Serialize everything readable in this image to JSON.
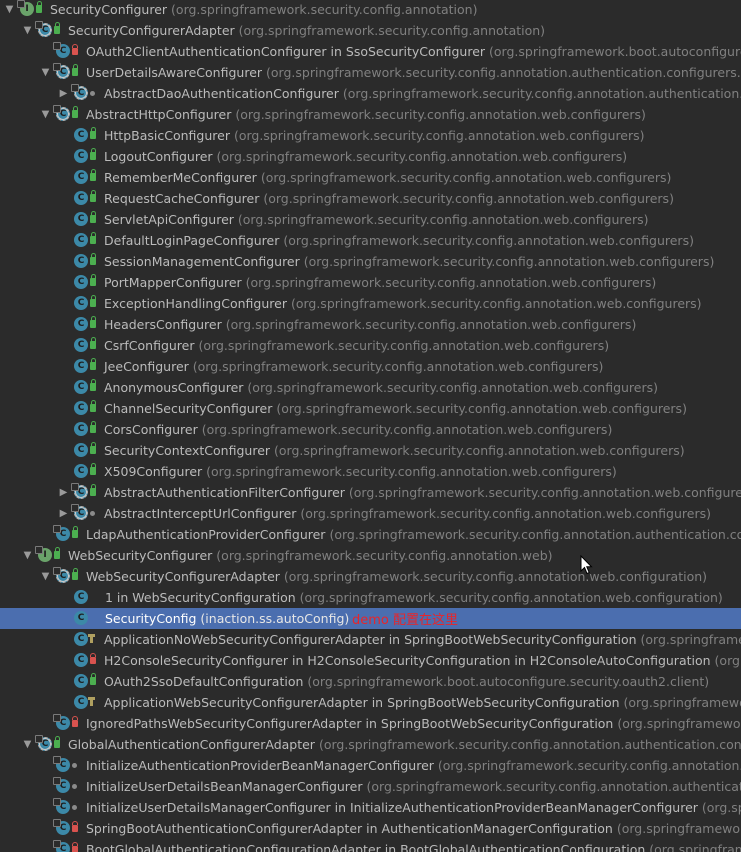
{
  "tree": [
    {
      "name": "SecurityConfigurer",
      "pkg": "(org.springframework.security.config.annotation)",
      "level": 0,
      "arrow": "down",
      "icon": "interface",
      "vis": "public"
    },
    {
      "name": "SecurityConfigurerAdapter",
      "pkg": "(org.springframework.security.config.annotation)",
      "level": 1,
      "arrow": "down",
      "icon": "abstract-class",
      "vis": "public"
    },
    {
      "name": "OAuth2ClientAuthenticationConfigurer in SsoSecurityConfigurer",
      "pkg": "(org.springframework.boot.autoconfigure.securit",
      "level": 2,
      "arrow": "none",
      "icon": "class",
      "vis": "private"
    },
    {
      "name": "UserDetailsAwareConfigurer",
      "pkg": "(org.springframework.security.config.annotation.authentication.configurers.userdeta",
      "level": 2,
      "arrow": "down",
      "icon": "abstract-class",
      "vis": "public"
    },
    {
      "name": "AbstractDaoAuthenticationConfigurer",
      "pkg": "(org.springframework.security.config.annotation.authentication.configur",
      "level": 3,
      "arrow": "right",
      "icon": "abstract-class",
      "vis": "package"
    },
    {
      "name": "AbstractHttpConfigurer",
      "pkg": "(org.springframework.security.config.annotation.web.configurers)",
      "level": 2,
      "arrow": "down",
      "icon": "abstract-class",
      "vis": "public"
    },
    {
      "name": "HttpBasicConfigurer",
      "pkg": "(org.springframework.security.config.annotation.web.configurers)",
      "level": 3,
      "arrow": "none",
      "icon": "class",
      "vis": "public"
    },
    {
      "name": "LogoutConfigurer",
      "pkg": "(org.springframework.security.config.annotation.web.configurers)",
      "level": 3,
      "arrow": "none",
      "icon": "class",
      "vis": "public"
    },
    {
      "name": "RememberMeConfigurer",
      "pkg": "(org.springframework.security.config.annotation.web.configurers)",
      "level": 3,
      "arrow": "none",
      "icon": "class",
      "vis": "public"
    },
    {
      "name": "RequestCacheConfigurer",
      "pkg": "(org.springframework.security.config.annotation.web.configurers)",
      "level": 3,
      "arrow": "none",
      "icon": "class",
      "vis": "public"
    },
    {
      "name": "ServletApiConfigurer",
      "pkg": "(org.springframework.security.config.annotation.web.configurers)",
      "level": 3,
      "arrow": "none",
      "icon": "class",
      "vis": "public"
    },
    {
      "name": "DefaultLoginPageConfigurer",
      "pkg": "(org.springframework.security.config.annotation.web.configurers)",
      "level": 3,
      "arrow": "none",
      "icon": "class",
      "vis": "public"
    },
    {
      "name": "SessionManagementConfigurer",
      "pkg": "(org.springframework.security.config.annotation.web.configurers)",
      "level": 3,
      "arrow": "none",
      "icon": "class",
      "vis": "public"
    },
    {
      "name": "PortMapperConfigurer",
      "pkg": "(org.springframework.security.config.annotation.web.configurers)",
      "level": 3,
      "arrow": "none",
      "icon": "class",
      "vis": "public"
    },
    {
      "name": "ExceptionHandlingConfigurer",
      "pkg": "(org.springframework.security.config.annotation.web.configurers)",
      "level": 3,
      "arrow": "none",
      "icon": "class",
      "vis": "public"
    },
    {
      "name": "HeadersConfigurer",
      "pkg": "(org.springframework.security.config.annotation.web.configurers)",
      "level": 3,
      "arrow": "none",
      "icon": "class",
      "vis": "public"
    },
    {
      "name": "CsrfConfigurer",
      "pkg": "(org.springframework.security.config.annotation.web.configurers)",
      "level": 3,
      "arrow": "none",
      "icon": "class",
      "vis": "public"
    },
    {
      "name": "JeeConfigurer",
      "pkg": "(org.springframework.security.config.annotation.web.configurers)",
      "level": 3,
      "arrow": "none",
      "icon": "class",
      "vis": "public"
    },
    {
      "name": "AnonymousConfigurer",
      "pkg": "(org.springframework.security.config.annotation.web.configurers)",
      "level": 3,
      "arrow": "none",
      "icon": "class",
      "vis": "public"
    },
    {
      "name": "ChannelSecurityConfigurer",
      "pkg": "(org.springframework.security.config.annotation.web.configurers)",
      "level": 3,
      "arrow": "none",
      "icon": "class",
      "vis": "public"
    },
    {
      "name": "CorsConfigurer",
      "pkg": "(org.springframework.security.config.annotation.web.configurers)",
      "level": 3,
      "arrow": "none",
      "icon": "class",
      "vis": "public"
    },
    {
      "name": "SecurityContextConfigurer",
      "pkg": "(org.springframework.security.config.annotation.web.configurers)",
      "level": 3,
      "arrow": "none",
      "icon": "class",
      "vis": "public"
    },
    {
      "name": "X509Configurer",
      "pkg": "(org.springframework.security.config.annotation.web.configurers)",
      "level": 3,
      "arrow": "none",
      "icon": "class",
      "vis": "public"
    },
    {
      "name": "AbstractAuthenticationFilterConfigurer",
      "pkg": "(org.springframework.security.config.annotation.web.configurers)",
      "level": 3,
      "arrow": "right",
      "icon": "abstract-class",
      "vis": "public"
    },
    {
      "name": "AbstractInterceptUrlConfigurer",
      "pkg": "(org.springframework.security.config.annotation.web.configurers)",
      "level": 3,
      "arrow": "right",
      "icon": "abstract-class",
      "vis": "package"
    },
    {
      "name": "LdapAuthenticationProviderConfigurer",
      "pkg": "(org.springframework.security.config.annotation.authentication.configurer",
      "level": 2,
      "arrow": "none",
      "icon": "class",
      "vis": "public"
    },
    {
      "name": "WebSecurityConfigurer",
      "pkg": "(org.springframework.security.config.annotation.web)",
      "level": 1,
      "arrow": "down",
      "icon": "interface",
      "vis": "public"
    },
    {
      "name": "WebSecurityConfigurerAdapter",
      "pkg": "(org.springframework.security.config.annotation.web.configuration)",
      "level": 2,
      "arrow": "down",
      "icon": "abstract-class",
      "vis": "public"
    },
    {
      "name": "1 in WebSecurityConfiguration",
      "pkg": "(org.springframework.security.config.annotation.web.configuration)",
      "level": 3,
      "arrow": "none",
      "icon": "class",
      "vis": "none"
    },
    {
      "name": "SecurityConfig",
      "pkg": "(inaction.ss.autoConfig)",
      "level": 3,
      "arrow": "none",
      "icon": "class",
      "vis": "none",
      "selected": true
    },
    {
      "name": "ApplicationNoWebSecurityConfigurerAdapter in SpringBootWebSecurityConfiguration",
      "pkg": "(org.springframework.",
      "level": 3,
      "arrow": "none",
      "icon": "class",
      "vis": "protected"
    },
    {
      "name": "H2ConsoleSecurityConfigurer in H2ConsoleSecurityConfiguration in H2ConsoleAutoConfiguration",
      "pkg": "(org.springf",
      "level": 3,
      "arrow": "none",
      "icon": "class",
      "vis": "private"
    },
    {
      "name": "OAuth2SsoDefaultConfiguration",
      "pkg": "(org.springframework.boot.autoconfigure.security.oauth2.client)",
      "level": 3,
      "arrow": "none",
      "icon": "class",
      "vis": "public"
    },
    {
      "name": "ApplicationWebSecurityConfigurerAdapter in SpringBootWebSecurityConfiguration",
      "pkg": "(org.springframework.boo",
      "level": 3,
      "arrow": "none",
      "icon": "class",
      "vis": "protected"
    },
    {
      "name": "IgnoredPathsWebSecurityConfigurerAdapter in SpringBootWebSecurityConfiguration",
      "pkg": "(org.springframework.boo",
      "level": 2,
      "arrow": "none",
      "icon": "class",
      "vis": "private"
    },
    {
      "name": "GlobalAuthenticationConfigurerAdapter",
      "pkg": "(org.springframework.security.config.annotation.authentication.configurers)",
      "level": 1,
      "arrow": "down",
      "icon": "abstract-class",
      "vis": "public"
    },
    {
      "name": "InitializeAuthenticationProviderBeanManagerConfigurer",
      "pkg": "(org.springframework.security.config.annotation.authent",
      "level": 2,
      "arrow": "none",
      "icon": "class",
      "vis": "package"
    },
    {
      "name": "InitializeUserDetailsBeanManagerConfigurer",
      "pkg": "(org.springframework.security.config.annotation.authentication.conf",
      "level": 2,
      "arrow": "none",
      "icon": "class",
      "vis": "package"
    },
    {
      "name": "InitializeUserDetailsManagerConfigurer in InitializeAuthenticationProviderBeanManagerConfigurer",
      "pkg": "(org.springfra",
      "level": 2,
      "arrow": "none",
      "icon": "class",
      "vis": "package"
    },
    {
      "name": "SpringBootAuthenticationConfigurerAdapter in AuthenticationManagerConfiguration",
      "pkg": "(org.springframework.boot",
      "level": 2,
      "arrow": "none",
      "icon": "class",
      "vis": "private"
    },
    {
      "name": "BootGlobalAuthenticationConfigurationAdapter in BootGlobalAuthenticationConfiguration",
      "pkg": "(org.springframework.boo",
      "level": 2,
      "arrow": "none",
      "icon": "class",
      "vis": "private"
    }
  ],
  "annotation": "demo 配置在这里",
  "colors": {
    "background": "#2b2b2b",
    "selection": "#4b6eaf",
    "class_icon": "#3c89a8",
    "interface_icon": "#6aa36a",
    "public": "#4caf50",
    "private": "#d9534f",
    "annotation": "#e8252a"
  }
}
